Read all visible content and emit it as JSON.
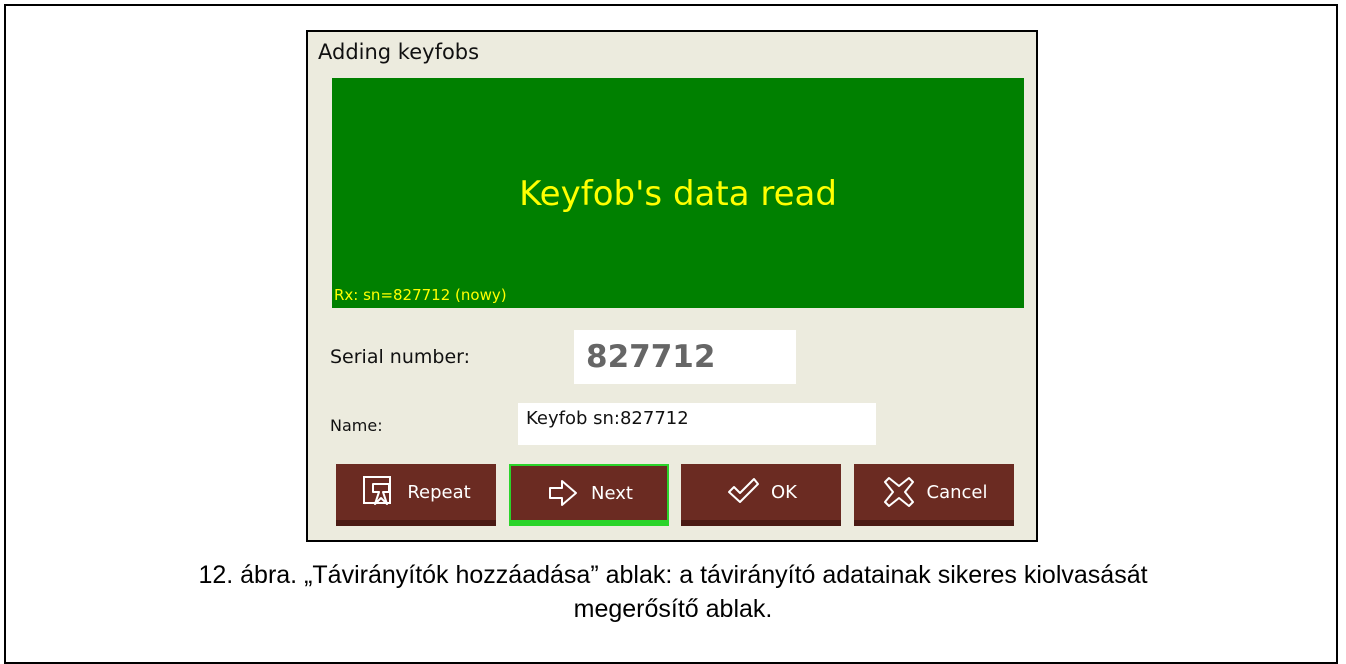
{
  "dialog": {
    "title": "Adding keyfobs",
    "status_message": "Keyfob's data read",
    "rx_line": "Rx: sn=827712 (nowy)",
    "serial_label": "Serial number:",
    "serial_value": "827712",
    "name_label": "Name:",
    "name_value": "Keyfob sn:827712"
  },
  "buttons": {
    "repeat": "Repeat",
    "next": "Next",
    "ok": "OK",
    "cancel": "Cancel"
  },
  "caption": {
    "line1": "12. ábra. „Távirányítók hozzáadása” ablak: a távirányító adatainak sikeres kiolvasását",
    "line2": "megerősítő ablak."
  },
  "colors": {
    "panel_bg": "#008000",
    "panel_text": "#ffff00",
    "button_bg": "#6b2b22",
    "next_border": "#2bd42b",
    "dialog_bg": "#ecebde"
  }
}
